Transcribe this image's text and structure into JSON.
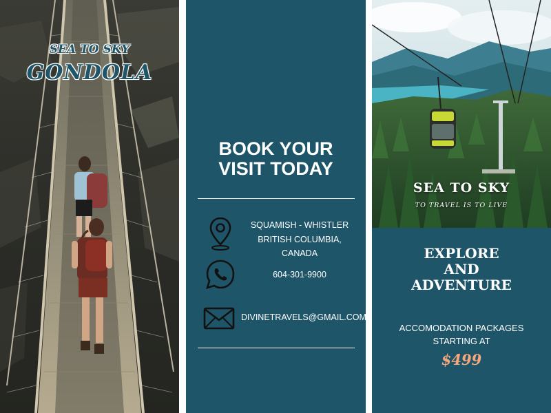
{
  "left_panel": {
    "title_line1": "SEA TO SKY",
    "title_line2": "GONDOLA",
    "image": "suspension-bridge-photo"
  },
  "middle_panel": {
    "heading_line1": "BOOK YOUR",
    "heading_line2": "VISIT TODAY",
    "contacts": [
      {
        "icon": "location-pin-icon",
        "line1": "SQUAMISH - WHISTLER",
        "line2": "BRITISH COLUMBIA, CANADA"
      },
      {
        "icon": "whatsapp-phone-icon",
        "line1": "604-301-9900"
      },
      {
        "icon": "mail-envelope-icon",
        "line1": "DIVINETRAVELS@GMAIL.COM"
      }
    ]
  },
  "right_panel": {
    "image": "gondola-mountain-photo",
    "photo_title": "SEA TO SKY",
    "photo_tagline": "TO TRAVEL IS TO LIVE",
    "heading_line1": "EXPLORE",
    "heading_line2": "AND",
    "heading_line3": "ADVENTURE",
    "sub_line1": "ACCOMODATION PACKAGES",
    "sub_line2": "STARTING AT",
    "price": "$499"
  },
  "colors": {
    "teal": "#1e5568",
    "price_accent": "#f4a87c",
    "text": "#ffffff"
  }
}
